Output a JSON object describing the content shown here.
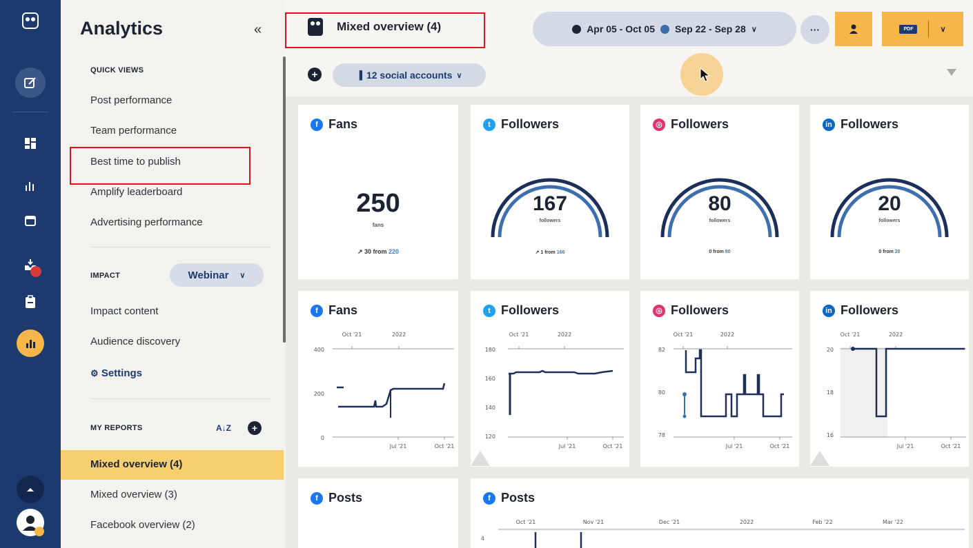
{
  "sidebar": {
    "title": "Analytics",
    "collapse": "«",
    "quick_views_label": "QUICK VIEWS",
    "quick_views": [
      "Post performance",
      "Team performance",
      "Best time to publish",
      "Amplify leaderboard",
      "Advertising performance"
    ],
    "impact_label": "IMPACT",
    "impact_select": "Webinar",
    "impact_items": [
      "Impact content",
      "Audience discovery"
    ],
    "settings": "Settings",
    "my_reports_label": "MY REPORTS",
    "sort_label": "A↓Z",
    "reports": [
      "Mixed overview (4)",
      "Mixed overview (3)",
      "Facebook overview (2)"
    ]
  },
  "header": {
    "title": "Mixed overview (4)",
    "date_range_1": "Apr 05 - Oct 05",
    "date_range_2": "Sep 22 - Sep 28",
    "more": "···",
    "pdf_label": "PDF",
    "accounts": "12 social accounts"
  },
  "colors": {
    "facebook": "#1877f2",
    "twitter": "#1da1f2",
    "instagram": "#e1306c",
    "linkedin": "#0a66c2",
    "accent": "#f7b64a",
    "navy": "#1c3a6e"
  },
  "summary": [
    {
      "network": "facebook",
      "label": "Fans",
      "value": "250",
      "unit": "fans",
      "delta": "30 from",
      "prev": "220",
      "arrow": "↗"
    },
    {
      "network": "twitter",
      "label": "Followers",
      "value": "167",
      "unit": "followers",
      "delta": "1 from",
      "prev": "166",
      "arrow": "↗"
    },
    {
      "network": "instagram",
      "label": "Followers",
      "value": "80",
      "unit": "followers",
      "delta": "0 from",
      "prev": "80",
      "arrow": ""
    },
    {
      "network": "linkedin",
      "label": "Followers",
      "value": "20",
      "unit": "followers",
      "delta": "0 from",
      "prev": "20",
      "arrow": ""
    }
  ],
  "trend": [
    {
      "network": "facebook",
      "label": "Fans",
      "top_ticks": [
        "Oct '21",
        "2022"
      ],
      "bottom_ticks": [
        "Jul '21",
        "Oct '21"
      ],
      "y_ticks": [
        "400",
        "200",
        "0"
      ]
    },
    {
      "network": "twitter",
      "label": "Followers",
      "top_ticks": [
        "Oct '21",
        "2022"
      ],
      "bottom_ticks": [
        "Jul '21",
        "Oct '21"
      ],
      "y_ticks": [
        "180",
        "160",
        "140",
        "120"
      ]
    },
    {
      "network": "instagram",
      "label": "Followers",
      "top_ticks": [
        "Oct '21",
        "2022"
      ],
      "bottom_ticks": [
        "Jul '21",
        "Oct '21"
      ],
      "y_ticks": [
        "82",
        "80",
        "78"
      ]
    },
    {
      "network": "linkedin",
      "label": "Followers",
      "top_ticks": [
        "Oct '21",
        "2022"
      ],
      "bottom_ticks": [
        "Jul '21",
        "Oct '21"
      ],
      "y_ticks": [
        "20",
        "18",
        "16"
      ]
    }
  ],
  "posts": [
    {
      "network": "facebook",
      "label": "Posts"
    },
    {
      "network": "facebook",
      "label": "Posts",
      "ticks": [
        "Oct '21",
        "Nov '21",
        "Dec '21",
        "2022",
        "Feb '22",
        "Mar '22"
      ],
      "y_tick": "4"
    }
  ]
}
